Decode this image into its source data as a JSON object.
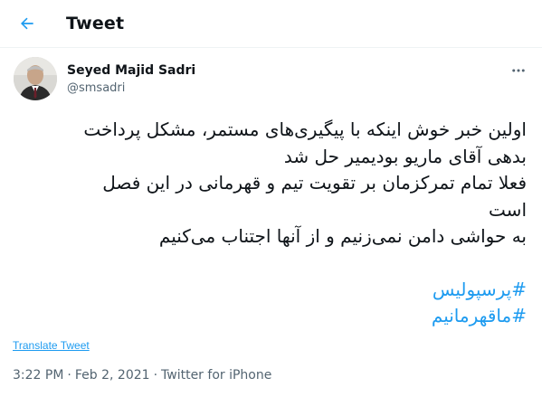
{
  "header": {
    "title": "Tweet",
    "back_icon": "arrow-left-icon"
  },
  "author": {
    "name": "Seyed Majid Sadri",
    "handle": "@smsadri",
    "avatar_icon": "user-avatar"
  },
  "more_icon": "more-horizontal-icon",
  "tweet": {
    "lines": [
      "اولین خبر خوش اینکه با پیگیری‌های مستمر، مشکل پرداخت",
      "بدهی آقای ماریو بودیمیر حل شد",
      "فعلا تمام تمرکزمان بر تقویت تیم و قهرمانی در این فصل",
      "است",
      "به حواشی دامن نمی‌زنیم و از آنها اجتناب می‌کنیم"
    ],
    "hashtags": [
      "#پرسپولیس",
      "#ماقهرمانیم"
    ]
  },
  "translate_label": "Translate Tweet",
  "meta": {
    "time": "3:22 PM",
    "date": "Feb 2, 2021",
    "source": "Twitter for iPhone"
  },
  "colors": {
    "accent": "#1d9bf0",
    "text": "#0f1419",
    "muted": "#536471"
  }
}
